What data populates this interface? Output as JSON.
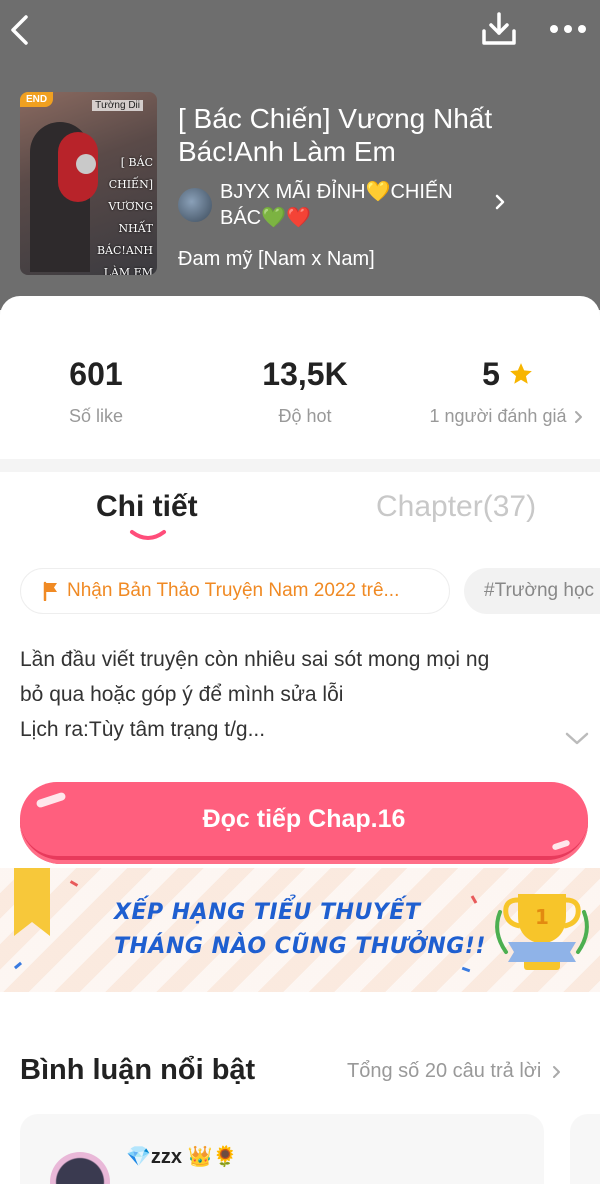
{
  "header": {
    "back_icon": "chevron-left-icon",
    "download_icon": "download-icon",
    "more_icon": "more-horizontal-icon"
  },
  "book": {
    "cover": {
      "status_badge": "END",
      "cover_author": "Tường Dii",
      "cover_title": "[ BÁC CHIẾN] VƯƠNG NHẤT BÁC!ANH LÀM EM THÍCH ANH MẤT RỒI"
    },
    "title": "[ Bác Chiến] Vương Nhất Bác!Anh Làm Em",
    "author": "BJYX MÃI ĐỈNH💛CHIẾN BÁC💚❤️",
    "genre": "Đam mỹ [Nam x Nam]"
  },
  "stats": {
    "likes": {
      "value": "601",
      "label": "Số like"
    },
    "hot": {
      "value": "13,5K",
      "label": "Độ hot"
    },
    "rating": {
      "value": "5",
      "label": "1 người đánh giá"
    }
  },
  "tabs": {
    "detail": "Chi tiết",
    "chapter": "Chapter(37)"
  },
  "chips": {
    "award": "Nhận Bản Thảo Truyện Nam 2022 trê...",
    "tag": "#Trường học"
  },
  "description": {
    "line1": "Lần đầu viết truyện còn nhiêu sai sót mong mọi ng",
    "line2": "bỏ qua hoặc góp ý để mình sửa lỗi",
    "line3": "Lịch ra:Tùy tâm trạng t/g..."
  },
  "read_button": "Đọc tiếp Chap.16",
  "banner": {
    "line1": "XẾP HẠNG TIỂU THUYẾT",
    "line2": "THÁNG NÀO CŨNG THƯỞNG!!"
  },
  "comments": {
    "title": "Bình luận nổi bật",
    "count": "Tổng số 20 câu trả lời",
    "first_user": "💎zzx 👑🌻"
  },
  "colors": {
    "header_bg": "#6e6e6e",
    "accent_pink": "#ff5f7e",
    "award_orange": "#f08a24",
    "star": "#f7b500",
    "banner_text": "#1f5fd0"
  }
}
